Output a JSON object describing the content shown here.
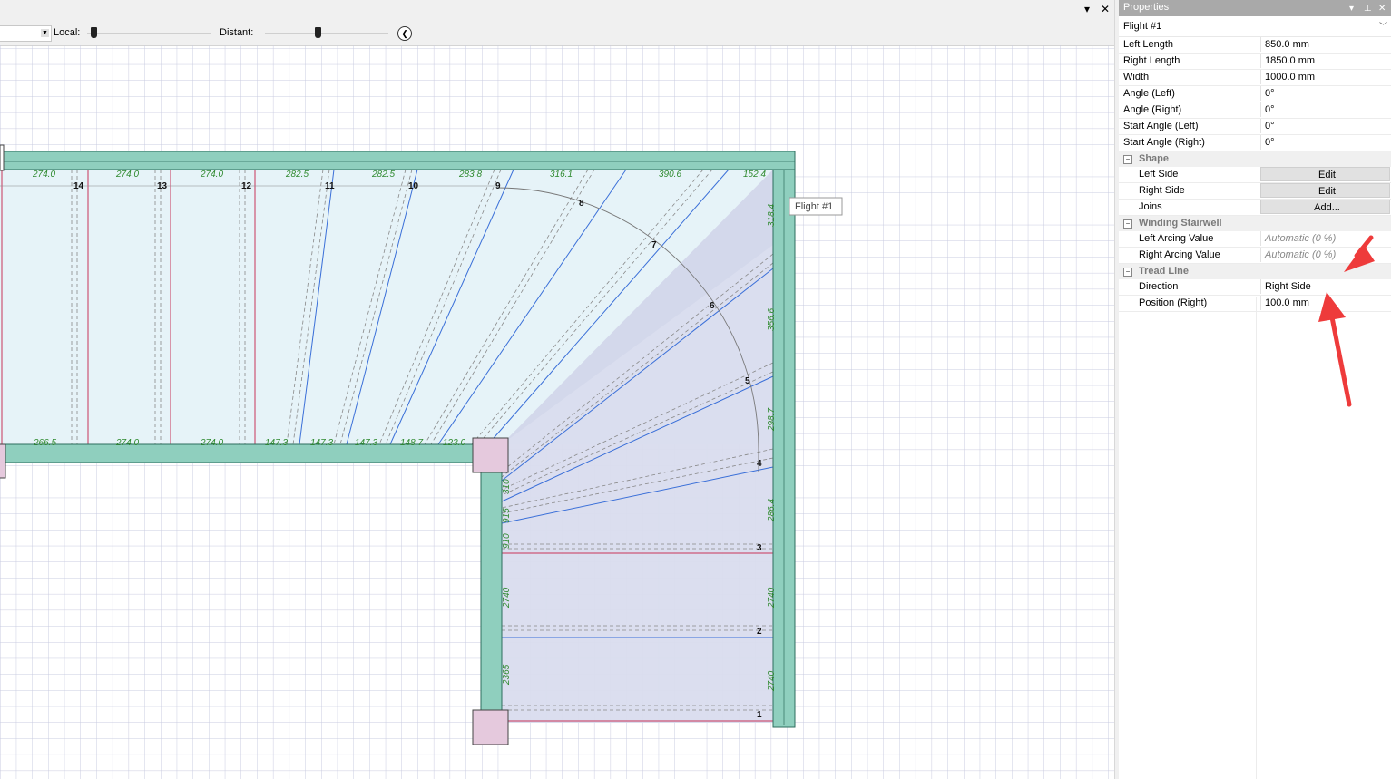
{
  "toolbar": {
    "local_label": "Local:",
    "distant_label": "Distant:",
    "local_slider_value": 0.05,
    "distant_slider_value": 0.42
  },
  "canvas": {
    "tooltip": "Flight #1",
    "top_dims": [
      "274.0",
      "274.0",
      "274.0",
      "282.5",
      "282.5",
      "283.8",
      "316.1",
      "390.6",
      "152.4"
    ],
    "bottom_dims": [
      "266.5",
      "274.0",
      "274.0",
      "147.3",
      "147.3",
      "147.3",
      "148.7",
      "123.0"
    ],
    "right_dims": [
      "318.4",
      "356.6",
      "298.7",
      "286.4",
      "2740",
      "2740"
    ],
    "inner_dims": [
      "310",
      "915",
      "910",
      "2740",
      "2365"
    ],
    "step_numbers": [
      "1",
      "2",
      "3",
      "4",
      "5",
      "6",
      "7",
      "8",
      "9",
      "10",
      "11",
      "12",
      "13",
      "14"
    ]
  },
  "properties": {
    "panel_title": "Properties",
    "object": "Flight #1",
    "rows": [
      {
        "k": "Left Length",
        "v": "850.0 mm"
      },
      {
        "k": "Right Length",
        "v": "1850.0 mm"
      },
      {
        "k": "Width",
        "v": "1000.0 mm"
      },
      {
        "k": "Angle (Left)",
        "v": "0°"
      },
      {
        "k": "Angle (Right)",
        "v": "0°"
      },
      {
        "k": "Start Angle (Left)",
        "v": "0°"
      },
      {
        "k": "Start Angle (Right)",
        "v": "0°"
      }
    ],
    "shape": {
      "label": "Shape",
      "left_side": "Left Side",
      "left_side_btn": "Edit",
      "right_side": "Right Side",
      "right_side_btn": "Edit",
      "joins": "Joins",
      "joins_btn": "Add..."
    },
    "winding": {
      "label": "Winding Stairwell",
      "left_arcing": "Left Arcing Value",
      "left_arcing_v": "Automatic (0 %)",
      "right_arcing": "Right Arcing Value",
      "right_arcing_v": "Automatic (0 %)"
    },
    "tread": {
      "label": "Tread Line",
      "direction": "Direction",
      "direction_v": "Right Side",
      "position": "Position (Right)",
      "position_v": "100.0 mm"
    }
  },
  "colors": {
    "wall": "#8fcfbe",
    "wall_stroke": "#2e6e5e",
    "stair_fill": "#e6f3f8",
    "winder_fill": "#d9dcee",
    "dim_text": "#2f8a2f",
    "tread_blue": "#3a6fd8",
    "riser_red": "#c8345a",
    "arrow_red": "#ee3b3b"
  }
}
